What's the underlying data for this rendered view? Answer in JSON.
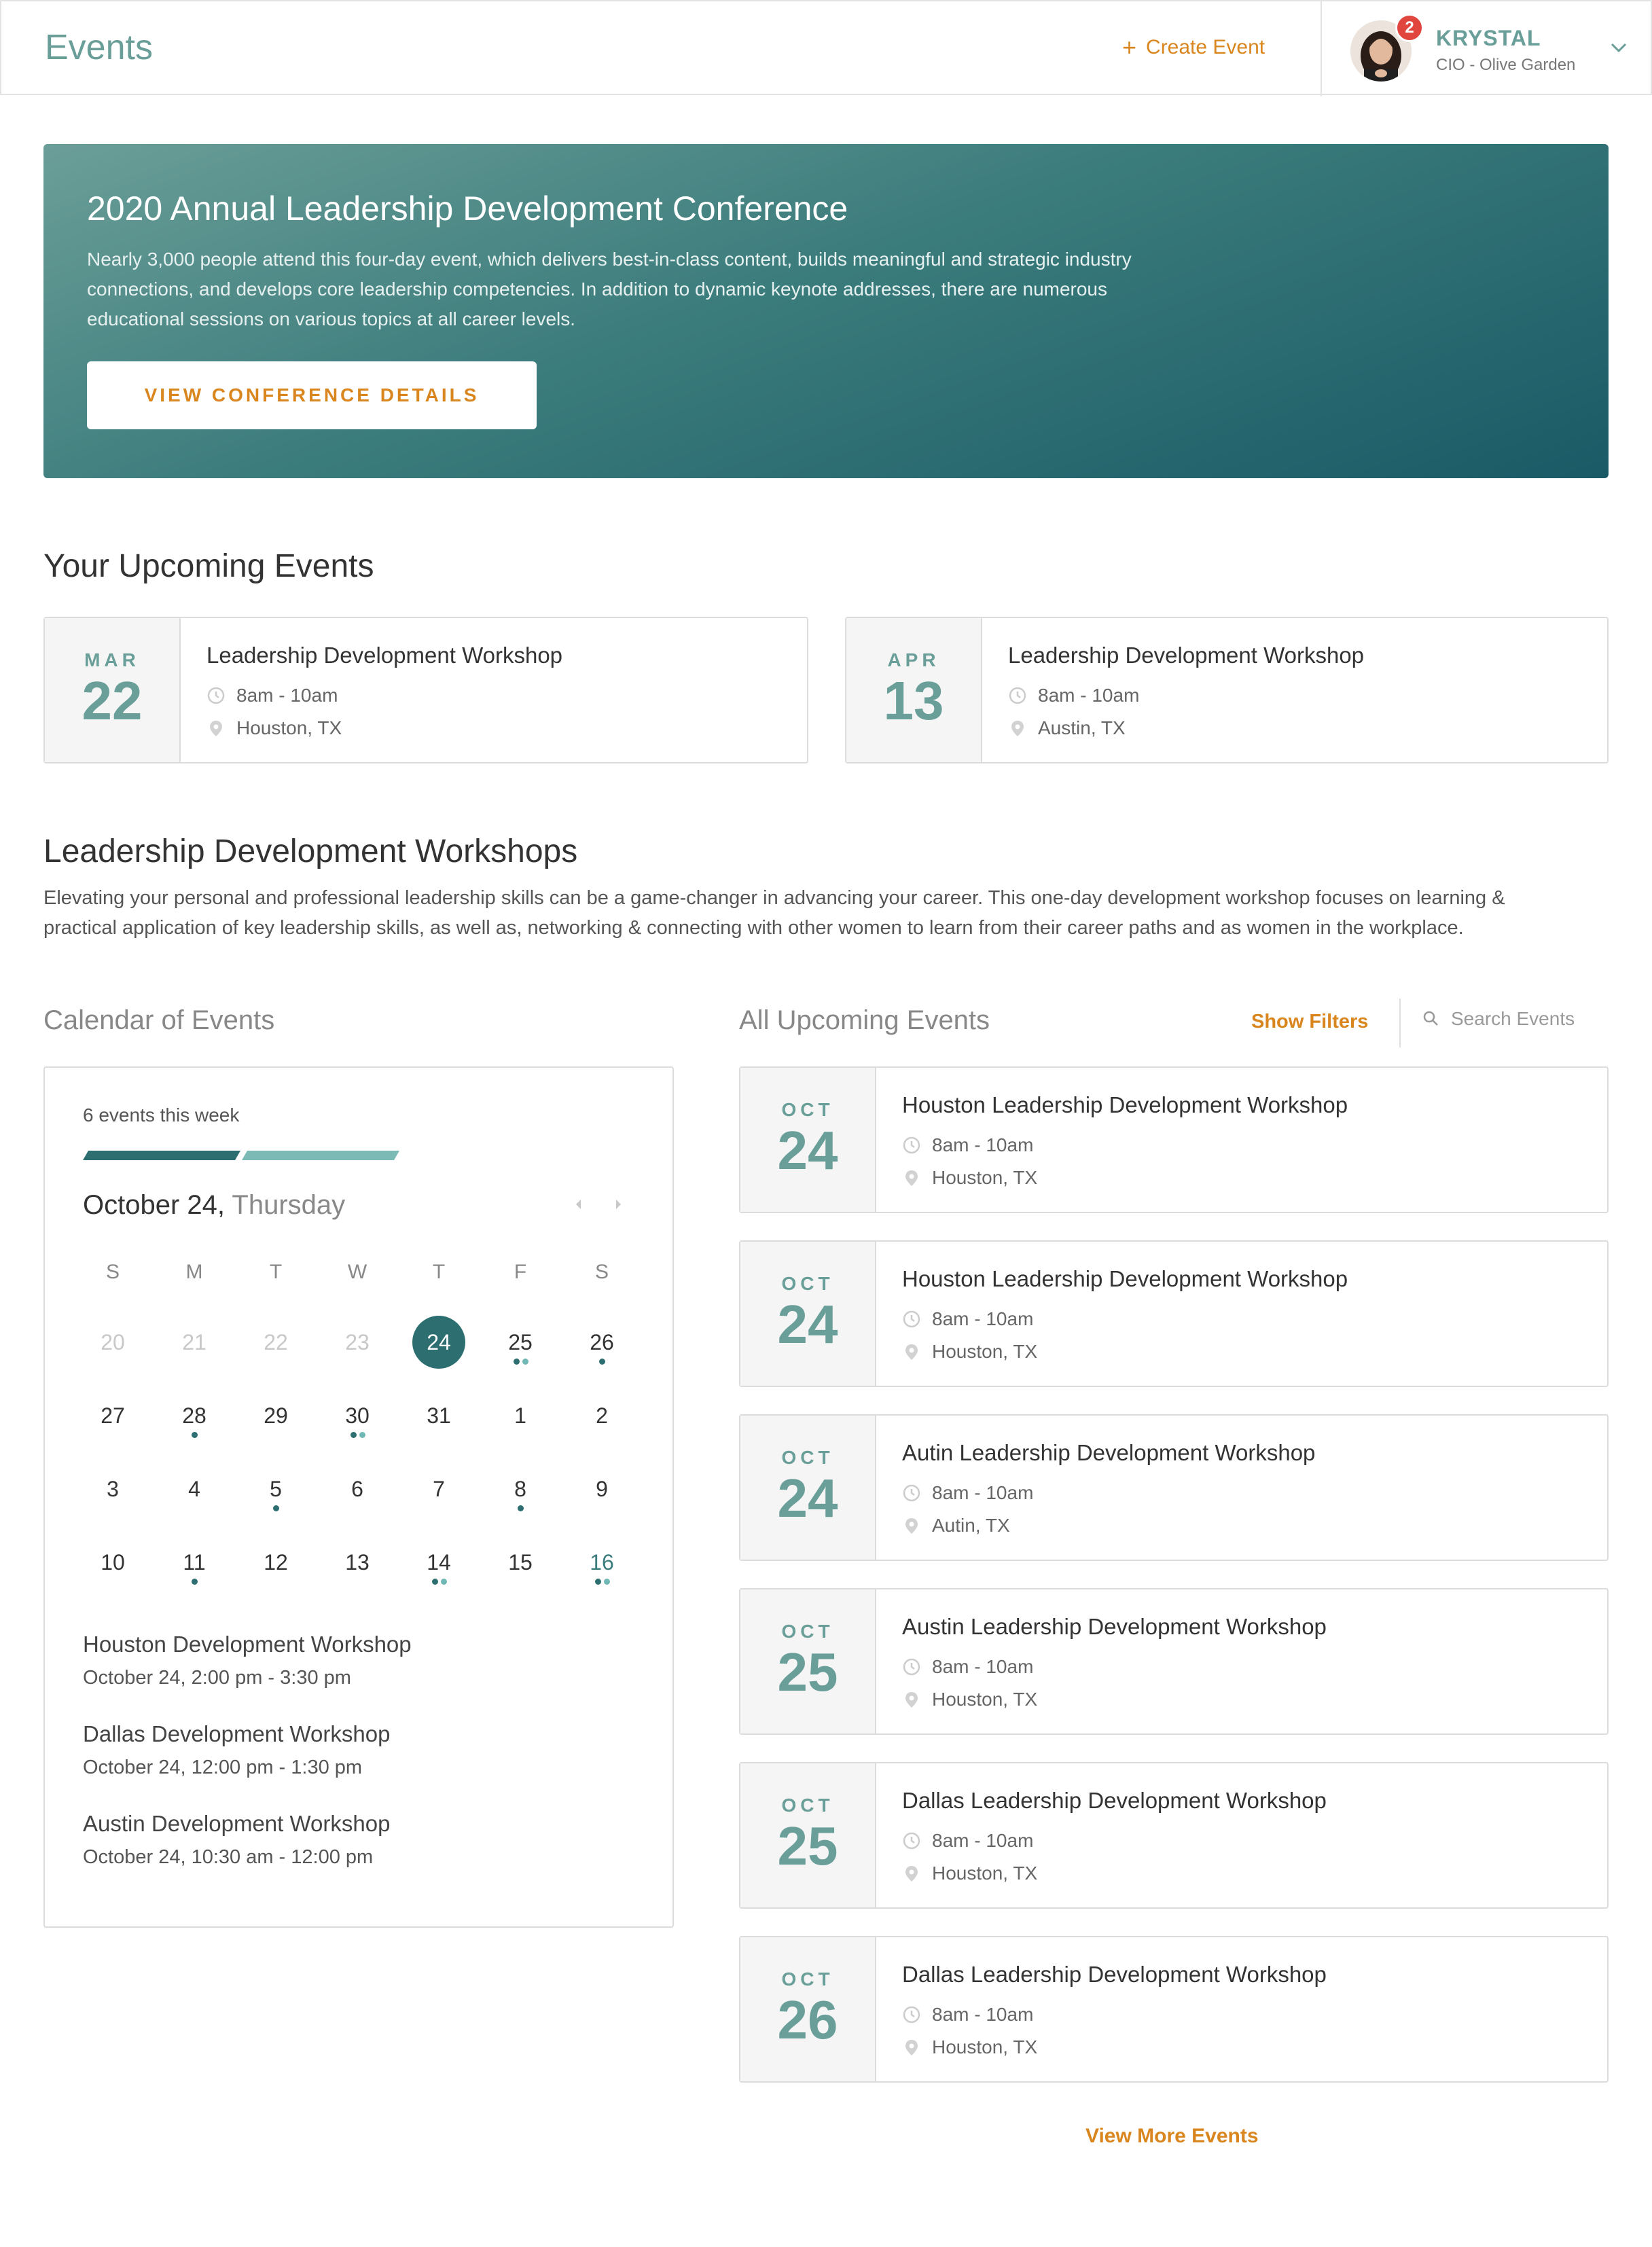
{
  "header": {
    "title": "Events",
    "create_label": "Create Event",
    "notification_count": "2",
    "user_name": "KRYSTAL",
    "user_role": "CIO - Olive Garden"
  },
  "hero": {
    "title": "2020 Annual Leadership Development Conference",
    "description": "Nearly 3,000 people attend this four-day event, which delivers best-in-class content, builds meaningful and strategic industry connections, and develops core leadership competencies. In addition to dynamic keynote addresses, there are numerous educational sessions on various topics at all career levels.",
    "button_label": "VIEW CONFERENCE DETAILS"
  },
  "upcoming": {
    "title": "Your Upcoming Events",
    "events": [
      {
        "month": "MAR",
        "day": "22",
        "title": "Leadership Development Workshop",
        "time": "8am - 10am",
        "location": "Houston, TX"
      },
      {
        "month": "APR",
        "day": "13",
        "title": "Leadership Development Workshop",
        "time": "8am - 10am",
        "location": "Austin, TX"
      }
    ]
  },
  "workshops": {
    "title": "Leadership Development Workshops",
    "description": "Elevating your personal and professional leadership skills can be a game-changer in advancing your career. This one-day development workshop focuses on learning & practical application of key leadership skills, as well as, networking & connecting with other women to learn from their career paths and as women in the workplace."
  },
  "calendar": {
    "title": "Calendar of Events",
    "week_count": "6 events this week",
    "date_label": "October 24,",
    "weekday_label": "Thursday",
    "dow": [
      "S",
      "M",
      "T",
      "W",
      "T",
      "F",
      "S"
    ],
    "weeks": [
      [
        "20",
        "21",
        "22",
        "23",
        "24",
        "25",
        "26"
      ],
      [
        "27",
        "28",
        "29",
        "30",
        "31",
        "1",
        "2"
      ],
      [
        "3",
        "4",
        "5",
        "6",
        "7",
        "8",
        "9"
      ],
      [
        "10",
        "11",
        "12",
        "13",
        "14",
        "15",
        "16"
      ]
    ],
    "events": [
      {
        "title": "Houston Development Workshop",
        "time": "October 24, 2:00 pm - 3:30 pm"
      },
      {
        "title": "Dallas Development Workshop",
        "time": "October 24, 12:00 pm - 1:30 pm"
      },
      {
        "title": "Austin Development Workshop",
        "time": "October 24, 10:30 am - 12:00 pm"
      }
    ],
    "colors": {
      "selected": "#2d6f70",
      "dot_dark": "#2d6f70",
      "dot_light": "#6fb8b4"
    }
  },
  "all_events": {
    "title": "All Upcoming Events",
    "show_filters_label": "Show Filters",
    "search_placeholder": "Search Events",
    "events": [
      {
        "month": "OCT",
        "day": "24",
        "title": "Houston Leadership Development Workshop",
        "time": "8am - 10am",
        "location": "Houston, TX"
      },
      {
        "month": "OCT",
        "day": "24",
        "title": "Houston Leadership Development Workshop",
        "time": "8am - 10am",
        "location": "Houston, TX"
      },
      {
        "month": "OCT",
        "day": "24",
        "title": "Autin Leadership Development Workshop",
        "time": "8am - 10am",
        "location": "Autin, TX"
      },
      {
        "month": "OCT",
        "day": "25",
        "title": "Austin Leadership Development Workshop",
        "time": "8am - 10am",
        "location": "Houston, TX"
      },
      {
        "month": "OCT",
        "day": "25",
        "title": "Dallas Leadership Development Workshop",
        "time": "8am - 10am",
        "location": "Houston, TX"
      },
      {
        "month": "OCT",
        "day": "26",
        "title": "Dallas Leadership Development Workshop",
        "time": "8am - 10am",
        "location": "Houston, TX"
      }
    ],
    "view_more_label": "View More Events"
  },
  "colors": {
    "accent": "#d9861f",
    "teal": "#6a9e99",
    "badge": "#e0463d"
  },
  "icons": [
    "plus-icon",
    "chevron-down-icon",
    "clock-icon",
    "location-pin-icon",
    "search-icon",
    "chevron-left-icon",
    "chevron-right-icon"
  ]
}
